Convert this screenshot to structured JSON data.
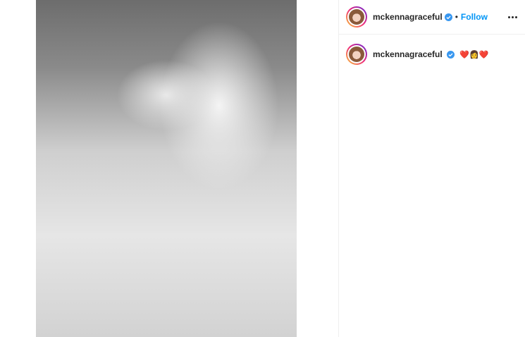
{
  "post": {
    "username": "mckennagraceful",
    "verified": true,
    "follow_label": "Follow",
    "separator": "•",
    "caption": "❤️👩❤️",
    "colors": {
      "follow": "#0095f6",
      "verified": "#3897f0",
      "border": "#efefef"
    }
  },
  "icons": {
    "verified_badge": "verified-badge-icon",
    "more_options": "more-options-icon"
  }
}
